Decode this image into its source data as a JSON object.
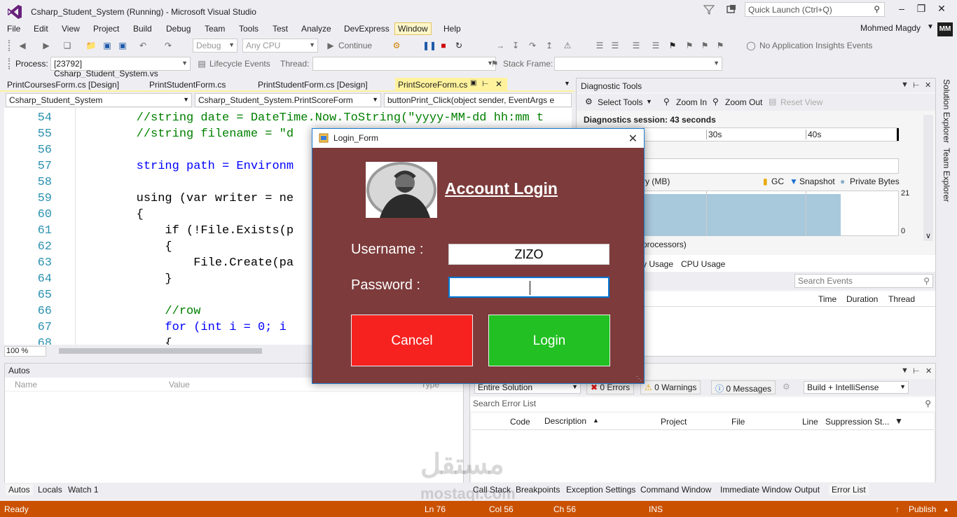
{
  "window": {
    "title": "Csharp_Student_System (Running) - Microsoft Visual Studio",
    "quick_launch_placeholder": "Quick Launch (Ctrl+Q)",
    "user_name": "Mohmed Magdy",
    "user_initials": "MM"
  },
  "menu": [
    "File",
    "Edit",
    "View",
    "Project",
    "Build",
    "Debug",
    "Team",
    "Tools",
    "Test",
    "Analyze",
    "DevExpress",
    "Window",
    "Help"
  ],
  "toolbar": {
    "config": "Debug",
    "platform": "Any CPU",
    "continue_label": "Continue",
    "insights_label": "No Application Insights Events"
  },
  "process_bar": {
    "process_label": "Process:",
    "process_value": "[23792] Csharp_Student_System.vs",
    "lifecycle_label": "Lifecycle Events",
    "thread_label": "Thread:",
    "stack_frame_label": "Stack Frame:"
  },
  "code_tabs": [
    "PrintCoursesForm.cs [Design]",
    "PrintStudentForm.cs",
    "PrintStudentForm.cs [Design]",
    "PrintScoreForm.cs"
  ],
  "nav": {
    "project": "Csharp_Student_System",
    "class": "Csharp_Student_System.PrintScoreForm",
    "member": "buttonPrint_Click(object sender, EventArgs e"
  },
  "editor": {
    "zoom": "100 %",
    "lines": [
      {
        "n": "54",
        "text": "        //string date = DateTime.Now.ToString(\"yyyy-MM-dd hh:mm t"
      },
      {
        "n": "55",
        "text": "        //string filename = \"d"
      },
      {
        "n": "56",
        "text": ""
      },
      {
        "n": "57",
        "text": "        string path = Environm"
      },
      {
        "n": "58",
        "text": ""
      },
      {
        "n": "59",
        "text": "        using (var writer = ne"
      },
      {
        "n": "60",
        "text": "        {"
      },
      {
        "n": "61",
        "text": "            if (!File.Exists(p"
      },
      {
        "n": "62",
        "text": "            {"
      },
      {
        "n": "63",
        "text": "                File.Create(pa"
      },
      {
        "n": "64",
        "text": "            }"
      },
      {
        "n": "65",
        "text": ""
      },
      {
        "n": "66",
        "text": "            //row"
      },
      {
        "n": "67",
        "text": "            for (int i = 0; i"
      },
      {
        "n": "68",
        "text": "            {"
      }
    ]
  },
  "diagnostics": {
    "title": "Diagnostic Tools",
    "select_tools": "Select Tools",
    "zoom_in": "Zoom In",
    "zoom_out": "Zoom Out",
    "reset_view": "Reset View",
    "session": "Diagnostics session: 43 seconds",
    "ticks": [
      "30s",
      "40s"
    ],
    "memory_label": "ry (MB)",
    "legend": [
      "GC",
      "Snapshot",
      "Private Bytes"
    ],
    "axis_max": "21",
    "axis_min": "0",
    "cpu_label": "processors)",
    "tabs": [
      "y Usage",
      "CPU Usage"
    ],
    "search_placeholder": "Search Events",
    "columns": [
      "Time",
      "Duration",
      "Thread"
    ]
  },
  "autos": {
    "title": "Autos",
    "columns": [
      "Name",
      "Value",
      "Type"
    ],
    "tabs": [
      "Autos",
      "Locals",
      "Watch 1"
    ]
  },
  "error_list": {
    "scope": "Entire Solution",
    "errors": "0 Errors",
    "warnings": "0 Warnings",
    "messages": "0 Messages",
    "build_filter": "Build + IntelliSense",
    "search_placeholder": "Search Error List",
    "columns": [
      "Code",
      "Description",
      "Project",
      "File",
      "Line",
      "Suppression St..."
    ],
    "tabs": [
      "Call Stack",
      "Breakpoints",
      "Exception Settings",
      "Command Window",
      "Immediate Window",
      "Output",
      "Error List"
    ]
  },
  "status": {
    "ready": "Ready",
    "ln": "Ln 76",
    "col": "Col 56",
    "ch": "Ch 56",
    "ins": "INS",
    "publish": "Publish"
  },
  "watermark": {
    "arabic": "مستقل",
    "latin": "mostaql.com"
  },
  "login_dialog": {
    "title": "Login_Form",
    "heading": "Account Login",
    "username_label": "Username :",
    "username_value": "ZIZO",
    "password_label": "Password :",
    "password_value": "",
    "cancel_label": "Cancel",
    "login_label": "Login",
    "colors": {
      "background": "#7d3b3b",
      "cancel": "#f5221f",
      "login": "#22c022"
    }
  }
}
